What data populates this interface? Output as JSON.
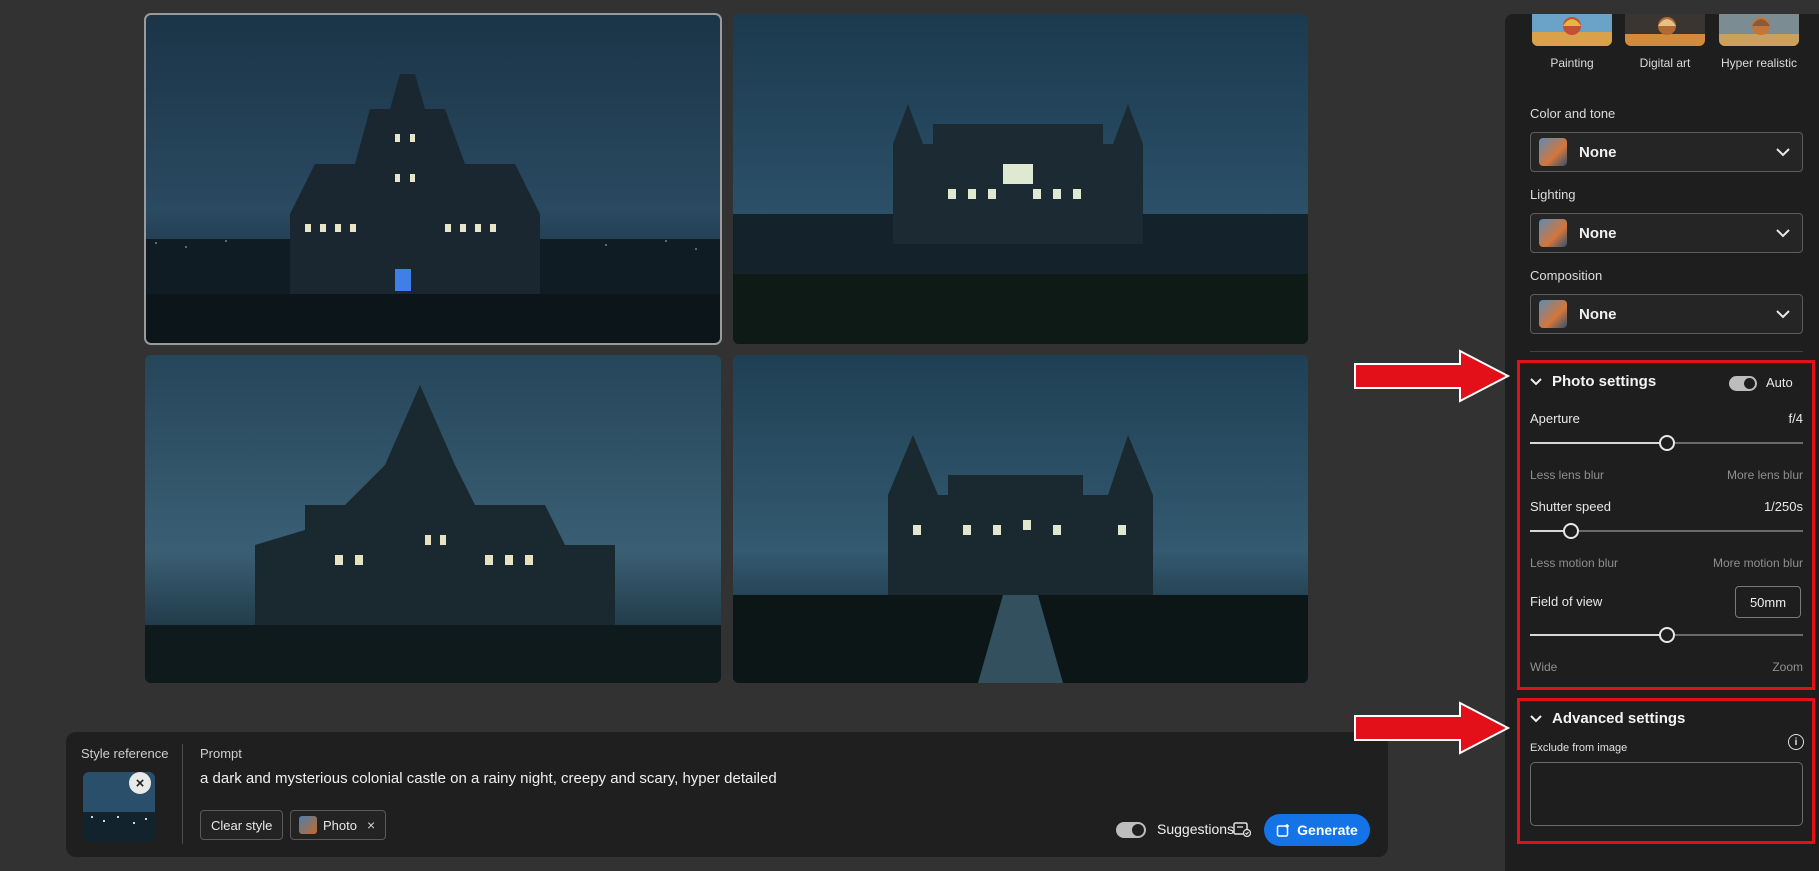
{
  "prompt_bar": {
    "style_reference_label": "Style reference",
    "prompt_label": "Prompt",
    "prompt_text": "a dark and mysterious colonial castle on a rainy night, creepy and scary, hyper detailed",
    "clear_style_label": "Clear style",
    "style_chip_label": "Photo",
    "style_chip_remove": "×",
    "suggestions_label": "Suggestions",
    "generate_label": "Generate"
  },
  "panel": {
    "styles": [
      {
        "label": "Painting"
      },
      {
        "label": "Digital art"
      },
      {
        "label": "Hyper realistic"
      }
    ],
    "color_and_tone": {
      "label": "Color and tone",
      "value": "None"
    },
    "lighting": {
      "label": "Lighting",
      "value": "None"
    },
    "composition": {
      "label": "Composition",
      "value": "None"
    },
    "photo_settings": {
      "title": "Photo settings",
      "auto_label": "Auto",
      "auto_on": true,
      "aperture": {
        "label": "Aperture",
        "value": "f/4",
        "position": 0.5,
        "min_hint": "Less lens blur",
        "max_hint": "More lens blur"
      },
      "shutter": {
        "label": "Shutter speed",
        "value": "1/250s",
        "position": 0.15,
        "min_hint": "Less motion blur",
        "max_hint": "More motion blur"
      },
      "fov": {
        "label": "Field of view",
        "value": "50mm",
        "position": 0.5,
        "min_hint": "Wide",
        "max_hint": "Zoom"
      }
    },
    "advanced_settings": {
      "title": "Advanced settings",
      "exclude_label": "Exclude from image",
      "exclude_value": ""
    }
  },
  "colors": {
    "accent": "#1473e6",
    "annotation": "#e3101a",
    "background": "#323232",
    "panel": "#1e1e1e"
  }
}
